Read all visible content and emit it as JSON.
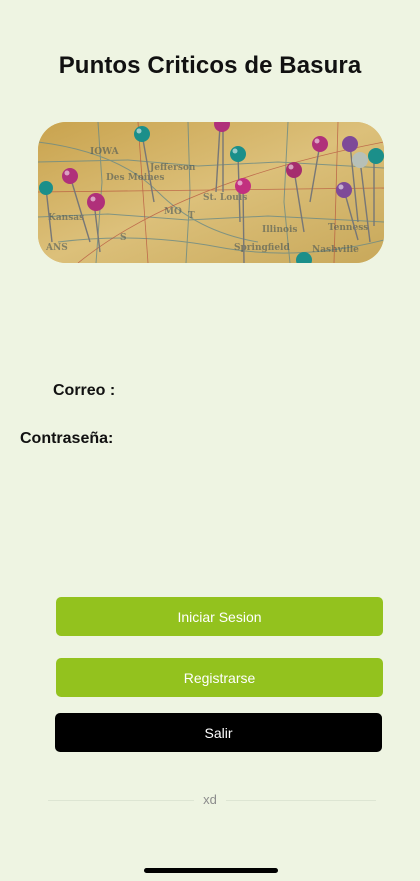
{
  "header": {
    "title": "Puntos Criticos de Basura"
  },
  "hero": {
    "image": "map-with-pins"
  },
  "form": {
    "email_label": "Correo :",
    "email_value": "",
    "password_label": "Contraseña:",
    "password_value": ""
  },
  "actions": {
    "login_label": "Iniciar Sesion",
    "register_label": "Registrarse",
    "exit_label": "Salir"
  },
  "footer": {
    "divider_text": "xd"
  },
  "colors": {
    "background": "#eef4e2",
    "accent_green": "#93c21e",
    "exit_button": "#000000"
  }
}
